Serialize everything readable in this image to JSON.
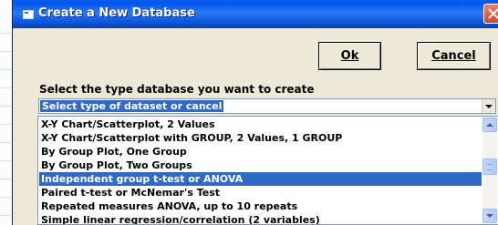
{
  "dialog": {
    "title": "Create a New Database"
  },
  "buttons": {
    "ok_label": "Ok",
    "cancel_label": "Cancel"
  },
  "prompt": "Select the type database you want to create",
  "combo": {
    "value": "Select type of dataset or cancel"
  },
  "list": {
    "items": [
      "X-Y Chart/Scatterplot, 2 Values",
      "X-Y Chart/Scatterplot with GROUP, 2 Values, 1 GROUP",
      "By Group Plot, One Group",
      "By Group Plot, Two Groups",
      "Independent group t-test or ANOVA",
      "Paired t-test or McNemar's Test",
      "Repeated measures ANOVA, up to 10 repeats",
      "Simple linear regression/correlation (2 variables)"
    ],
    "selected_index": 4
  },
  "colors": {
    "titlebar": "#0058ee",
    "selection": "#316ac5",
    "dialog_bg": "#ece9d8"
  }
}
